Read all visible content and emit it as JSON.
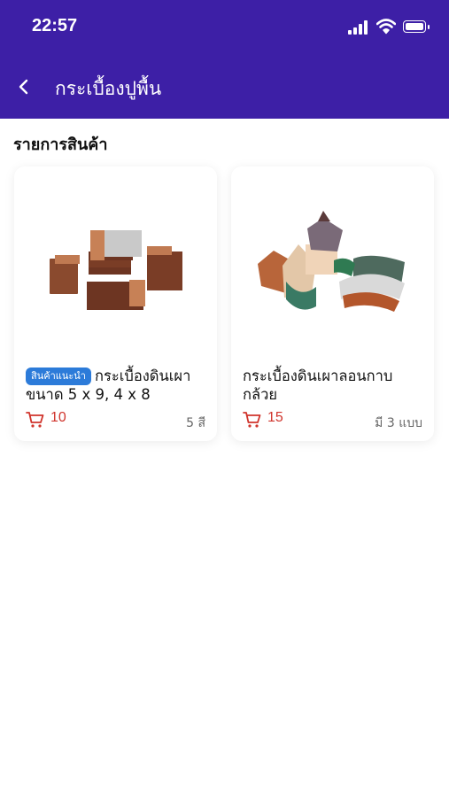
{
  "status_bar": {
    "time": "22:57",
    "icons": [
      "cellular-signal-icon",
      "wifi-icon",
      "battery-icon"
    ]
  },
  "header": {
    "back_icon": "chevron-left-icon",
    "title": "กระเบื้องปูพื้น"
  },
  "section": {
    "title": "รายการสินค้า"
  },
  "products": [
    {
      "badge": "สินค้าแนะนำ",
      "name": "กระเบื้องดินเผาขนาด 5 x 9, 4 x 8",
      "cart_count": "10",
      "variant": "5 สี"
    },
    {
      "badge": "",
      "name": "กระเบื้องดินเผาลอนกาบกล้วย",
      "cart_count": "15",
      "variant": "มี 3 แบบ"
    }
  ],
  "colors": {
    "header_bg": "#3d1fa6",
    "badge_bg": "#2c7bd9",
    "cart_accent": "#d0342c"
  }
}
